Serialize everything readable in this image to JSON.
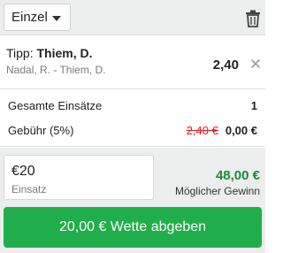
{
  "header": {
    "bet_type": "Einzel",
    "delete_icon": "trash-icon"
  },
  "selection": {
    "tip_prefix": "Tipp:",
    "tip_pick": "Thiem, D.",
    "event": "Nadal, R. - Thiem, D.",
    "odds": "2,40",
    "remove_icon": "close-icon"
  },
  "summary": {
    "total_stakes_label": "Gesamte Einsätze",
    "total_stakes_value": "1",
    "fee_label": "Gebühr (5%)",
    "fee_old": "2,40 €",
    "fee_new": "0,00 €"
  },
  "stake": {
    "value": "€20",
    "label": "Einsatz"
  },
  "win": {
    "amount": "48,00 €",
    "label": "Möglicher Gewinn"
  },
  "place_bet_button": "20,00 € Wette abgeben",
  "colors": {
    "accent_green": "#1fae4b",
    "win_green": "#1b8a3c",
    "strike_red": "#e01a1a",
    "panel_gray": "#eceded"
  }
}
